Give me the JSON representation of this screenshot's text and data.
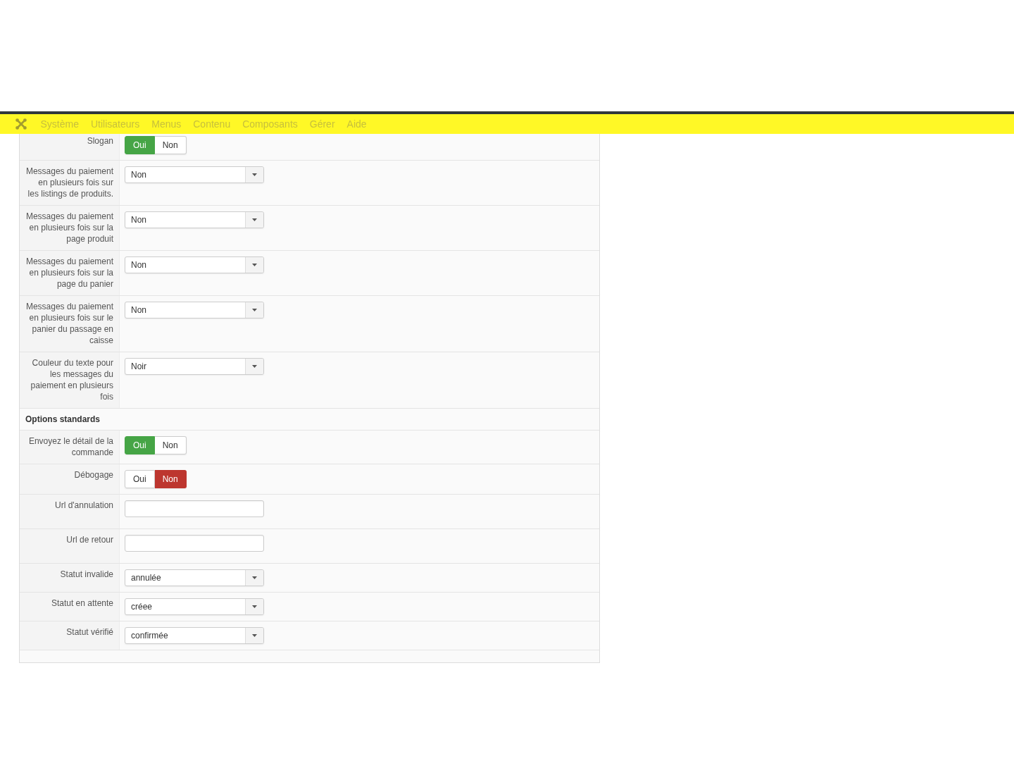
{
  "navbar": {
    "menu": [
      {
        "label": "Système"
      },
      {
        "label": "Utilisateurs"
      },
      {
        "label": "Menus"
      },
      {
        "label": "Contenu"
      },
      {
        "label": "Composants"
      },
      {
        "label": "Gérer"
      },
      {
        "label": "Aide"
      }
    ]
  },
  "form": {
    "groups": [
      {
        "rows": [
          {
            "kind": "toggle",
            "label": "Slogan",
            "options": [
              {
                "label": "Oui",
                "selected": true
              },
              {
                "label": "Non",
                "selected": false
              }
            ]
          },
          {
            "kind": "select",
            "label": "Messages du paiement en plusieurs fois sur les listings de produits.",
            "value": "Non"
          },
          {
            "kind": "select",
            "label": "Messages du paiement en plusieurs fois sur la page produit",
            "value": "Non"
          },
          {
            "kind": "select",
            "label": "Messages du paiement en plusieurs fois sur la page du panier",
            "value": "Non"
          },
          {
            "kind": "select",
            "label": "Messages du paiement en plusieurs fois sur le panier du passage en caisse",
            "value": "Non"
          },
          {
            "kind": "select",
            "label": "Couleur du texte pour les messages du paiement en plusieurs fois",
            "value": "Noir"
          }
        ]
      },
      {
        "title": "Options standards",
        "rows": [
          {
            "kind": "toggle",
            "label": "Envoyez le détail de la commande",
            "options": [
              {
                "label": "Oui",
                "selected": true
              },
              {
                "label": "Non",
                "selected": false
              }
            ]
          },
          {
            "kind": "toggle",
            "label": "Débogage",
            "options": [
              {
                "label": "Oui",
                "selected": false
              },
              {
                "label": "Non",
                "selected": true
              }
            ]
          },
          {
            "kind": "text",
            "label": "Url d'annulation"
          },
          {
            "kind": "text",
            "label": "Url de retour"
          },
          {
            "kind": "select",
            "label": "Statut invalide",
            "value": "annulée"
          },
          {
            "kind": "select",
            "label": "Statut en attente",
            "value": "créee"
          },
          {
            "kind": "select",
            "label": "Statut vérifié",
            "value": "confirmée"
          }
        ]
      }
    ]
  }
}
